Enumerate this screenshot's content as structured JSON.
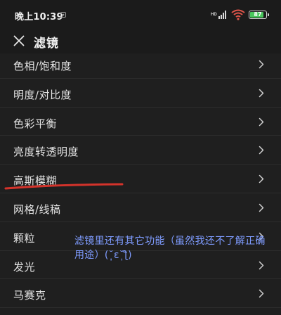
{
  "status_bar": {
    "time": "晚上10:39",
    "battery_level": "87",
    "battery_fraction": 0.87
  },
  "header": {
    "title": "滤镜"
  },
  "menu": {
    "items": [
      {
        "label": "色相/饱和度"
      },
      {
        "label": "明度/对比度"
      },
      {
        "label": "色彩平衡"
      },
      {
        "label": "亮度转透明度"
      },
      {
        "label": "高斯模糊"
      },
      {
        "label": "网格/线稿"
      },
      {
        "label": "颗粒"
      },
      {
        "label": "发光"
      },
      {
        "label": "马赛克"
      }
    ]
  },
  "annotation": {
    "text": "滤镜里还有其它功能（虽然我还不了解正确用途）(˘̩̩̩ε˘̩ƪ)"
  },
  "colors": {
    "background": "#1f1f1f",
    "annotation": "#7f9cff",
    "underline": "#d4332b",
    "battery": "#49c75c"
  },
  "icons": [
    "close-icon",
    "chevron-right-icon",
    "signal-icon",
    "wifi-icon",
    "battery-icon"
  ]
}
